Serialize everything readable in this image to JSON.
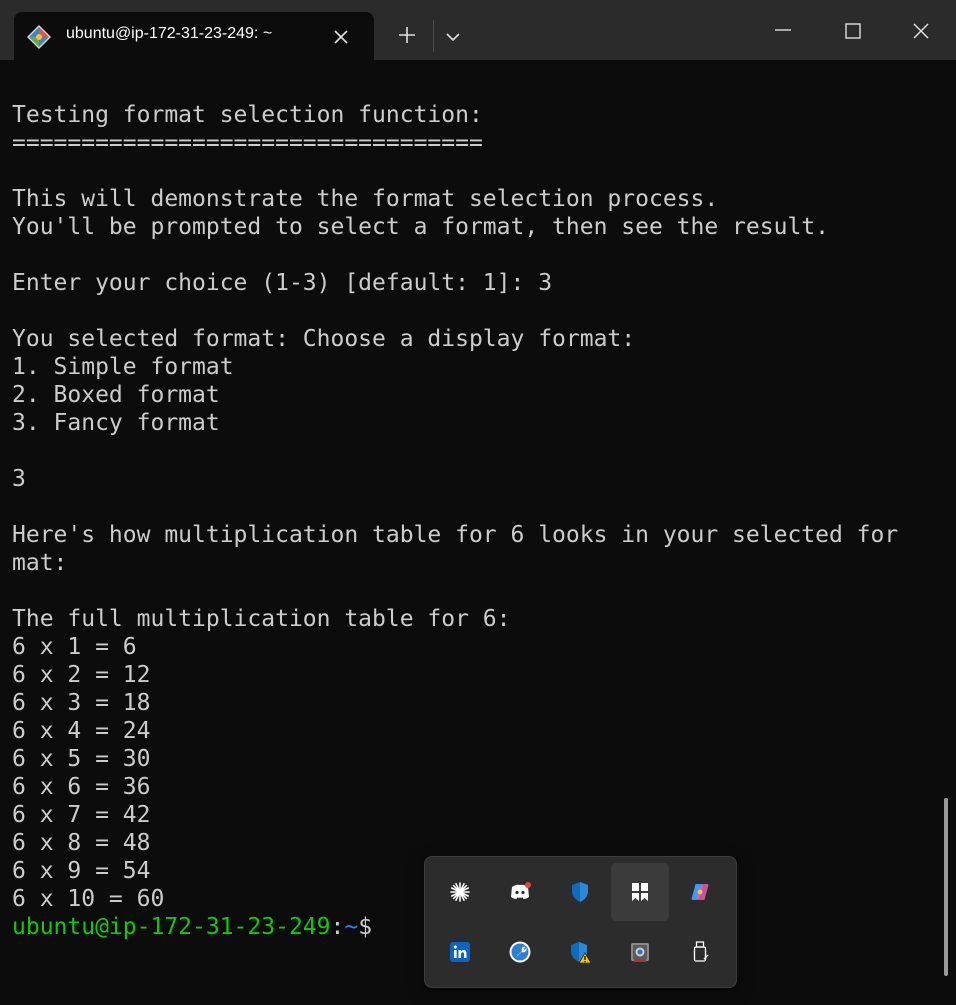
{
  "window": {
    "tab_title": "ubuntu@ip-172-31-23-249: ~",
    "tab_icon": "git-bash-icon",
    "new_tab_label": "+",
    "controls": [
      "minimize-icon",
      "maximize-icon",
      "close-icon"
    ]
  },
  "terminal": {
    "output": "Testing format selection function:\n==================================\n\nThis will demonstrate the format selection process.\nYou'll be prompted to select a format, then see the result.\n\nEnter your choice (1-3) [default: 1]: 3\n\nYou selected format: Choose a display format:\n1. Simple format\n2. Boxed format\n3. Fancy format\n\n3\n\nHere's how multiplication table for 6 looks in your selected for\nmat:\n\nThe full multiplication table for 6:\n6 x 1 = 6\n6 x 2 = 12\n6 x 3 = 18\n6 x 4 = 24\n6 x 5 = 30\n6 x 6 = 36\n6 x 7 = 42\n6 x 8 = 48\n6 x 9 = 54\n6 x 10 = 60\n",
    "prompt": {
      "user_host": "ubuntu@ip-172-31-23-249",
      "separator": ":",
      "path": "~",
      "symbol": "$"
    }
  },
  "tray": {
    "icons": [
      "asterisk-icon",
      "discord-icon",
      "windows-defender-icon",
      "notion-icon",
      "copilot-icon",
      "linkedin-icon",
      "wrench-tool-icon",
      "defender-warning-icon",
      "webcam-app-icon",
      "usb-drive-icon"
    ]
  },
  "colors": {
    "background": "#0c0c0c",
    "text": "#cccccc",
    "prompt_user": "#16c60c",
    "prompt_path": "#3b78ff",
    "titlebar": "#2b2b2b"
  }
}
